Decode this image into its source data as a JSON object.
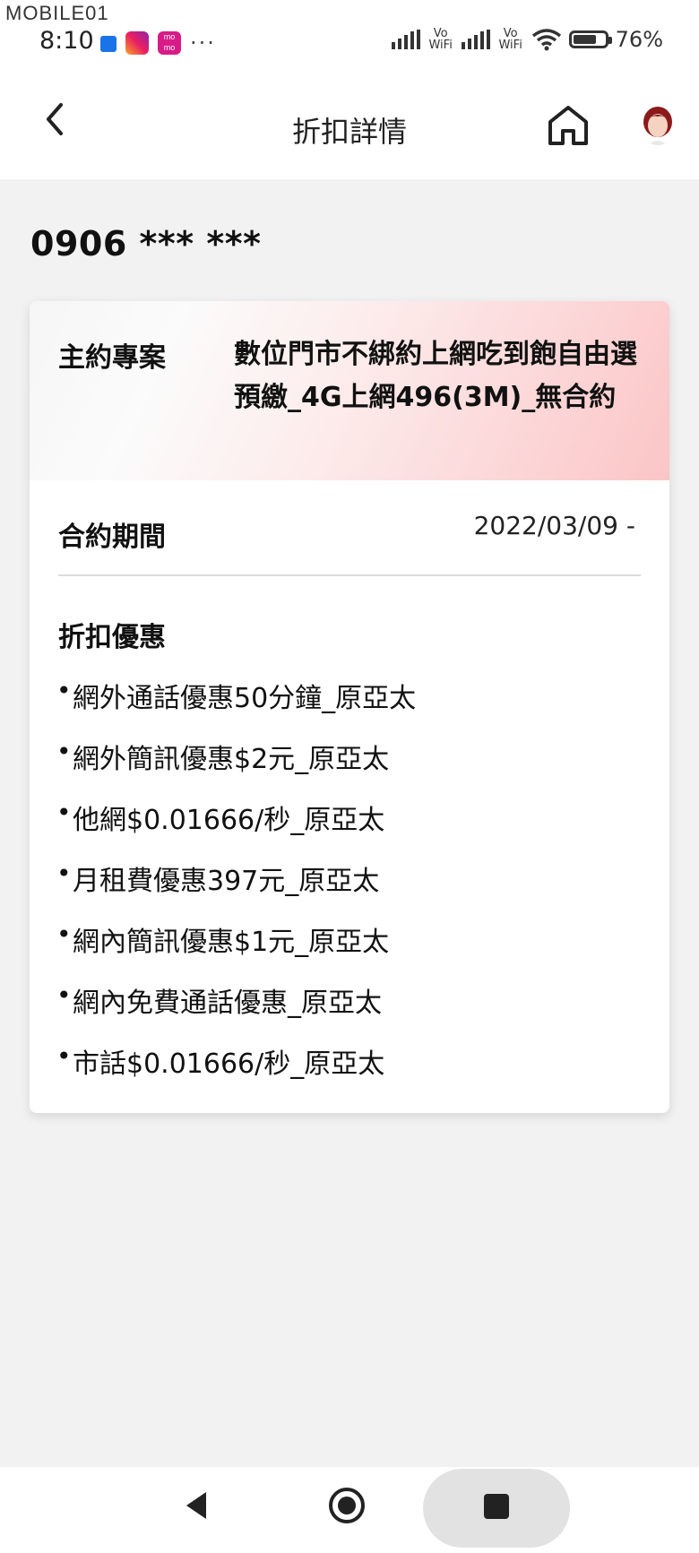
{
  "status_bar": {
    "watermark": "MOBILE01",
    "time": "8:10",
    "momo_label": "mo mo",
    "more_notifications": "···",
    "vowifi_1": "Vo WiFi",
    "vowifi_2": "Vo WiFi",
    "battery_level": 0.76,
    "battery_percent": "76%"
  },
  "header": {
    "title": "折扣詳情"
  },
  "account": {
    "phone_number": "0906 *** ***"
  },
  "plan": {
    "label": "主約專案",
    "name": "數位門市不綁約上網吃到飽自由選預繳_4G上網496(3M)_無合約",
    "period_label": "合約期間",
    "period_value": "2022/03/09 -",
    "discount_title": "折扣優惠",
    "discounts": [
      "網外通話優惠50分鐘_原亞太",
      "網外簡訊優惠$2元_原亞太",
      "他網$0.01666/秒_原亞太",
      "月租費優惠397元_原亞太",
      "網內簡訊優惠$1元_原亞太",
      "網內免費通話優惠_原亞太",
      "市話$0.01666/秒_原亞太"
    ]
  },
  "icons": {
    "back": "chevron-left-icon",
    "home": "home-icon",
    "avatar": "user-avatar",
    "nav_back": "triangle-back-icon",
    "nav_home": "circle-home-icon",
    "nav_recent": "square-recent-icon"
  }
}
